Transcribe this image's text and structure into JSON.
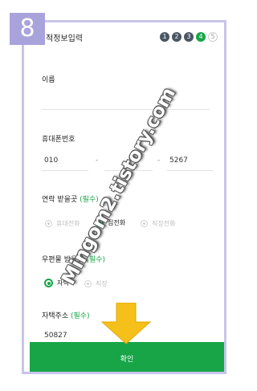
{
  "step_badge": "8",
  "header": {
    "title": "적정보입력",
    "steps": [
      "1",
      "2",
      "3",
      "4",
      "5"
    ],
    "active_step": 4
  },
  "fields": {
    "name_label": "이름",
    "phone_label": "휴대폰번호",
    "phone": {
      "part1": "010",
      "separator": "-",
      "part3": "5267"
    },
    "contact_label": "연락 받을곳",
    "contact_required": "(필수)",
    "contact_options": [
      "휴대전화",
      "집전화",
      "직장전화"
    ],
    "contact_selected": "집전화",
    "mail_label": "우편물 받을곳",
    "mail_required": "(필수)",
    "mail_options": [
      "자택",
      "직장"
    ],
    "mail_selected": "자택",
    "address_label": "자택주소",
    "address_required": "(필수)",
    "zipcode": "50827"
  },
  "confirm_label": "확인",
  "watermark": "Mingom2.tistory.com",
  "colors": {
    "accent": "#17a548",
    "frame": "#c8c4ec",
    "badge": "#a9a3dc",
    "arrow": "#f5c01a"
  }
}
